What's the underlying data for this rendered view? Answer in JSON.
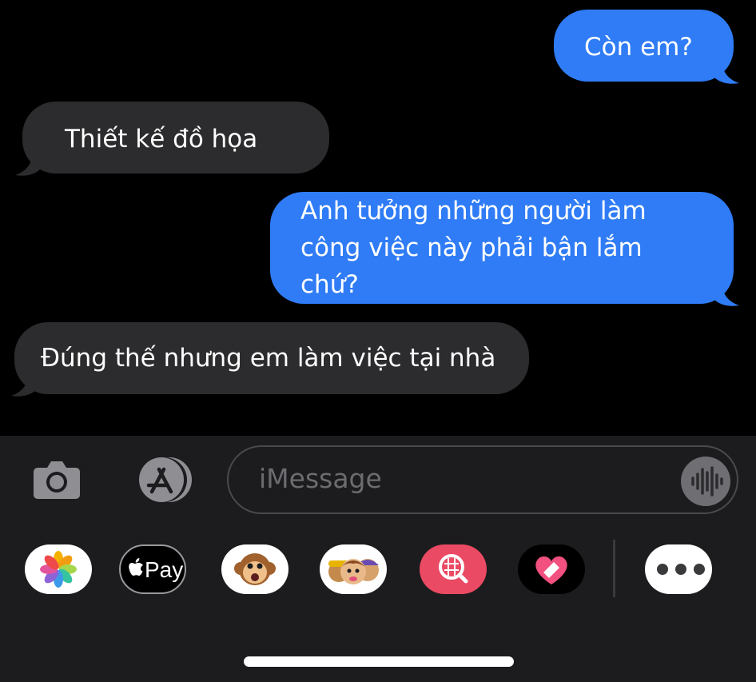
{
  "messages": [
    {
      "direction": "outgoing",
      "text": "Còn em?"
    },
    {
      "direction": "incoming",
      "text": "Thiết kế đồ họa"
    },
    {
      "direction": "outgoing",
      "lines": [
        "Anh tưởng những người làm",
        "công việc này phải bận lắm",
        "chứ?"
      ]
    },
    {
      "direction": "incoming",
      "text": "Đúng thế nhưng em làm việc tại nhà"
    }
  ],
  "composer": {
    "placeholder": "iMessage",
    "camera_icon": "camera-icon",
    "apps_icon": "app-store-icon",
    "voice_icon": "waveform-icon"
  },
  "app_drawer": {
    "apple_pay_label": "Pay",
    "apps": [
      "photos-icon",
      "apple-pay-icon",
      "animoji-icon",
      "memoji-icon",
      "image-search-icon",
      "digital-touch-icon",
      "more-icon"
    ]
  },
  "colors": {
    "outgoing_bubble": "#2f7cf6",
    "incoming_bubble": "#2c2c2e",
    "background": "#000000",
    "composer_background": "#1c1c1e"
  }
}
